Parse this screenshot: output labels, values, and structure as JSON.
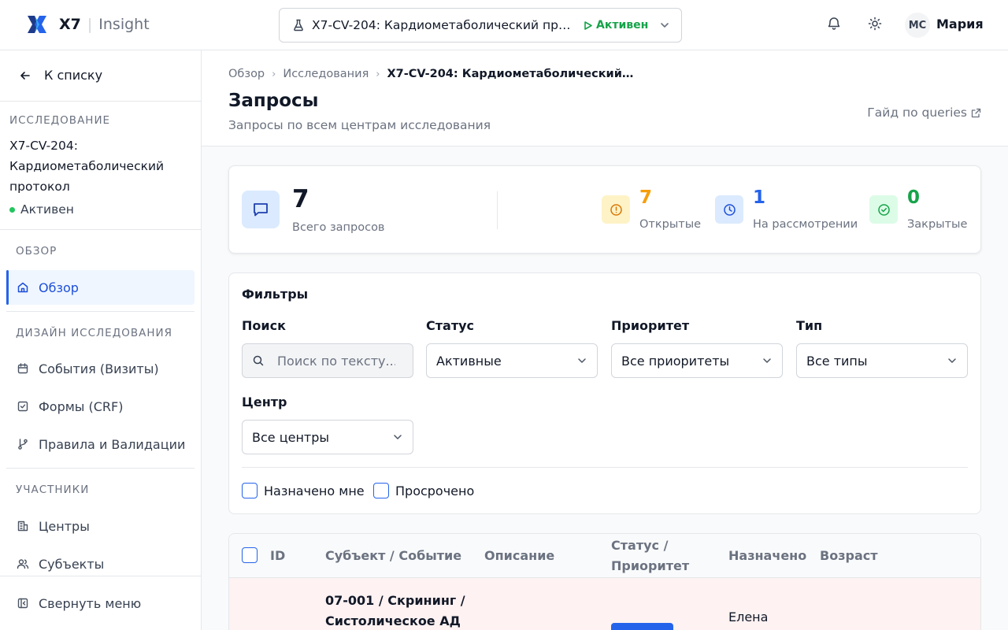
{
  "header": {
    "brand": "X7",
    "product": "Insight",
    "study": "X7-CV-204: Кардиометаболический протокол",
    "study_status": "Активен",
    "user_initials": "МС",
    "user_name": "Мария"
  },
  "sidebar": {
    "back_label": "К списку",
    "study_section": "ИССЛЕДОВАНИЕ",
    "study_name": "X7-CV-204: Кардиометаболический протокол",
    "study_status": "Активен",
    "sections": {
      "overview": "ОБЗОР",
      "design": "ДИЗАЙН ИССЛЕДОВАНИЯ",
      "participants": "УЧАСТНИКИ"
    },
    "items": {
      "overview": "Обзор",
      "events": "События (Визиты)",
      "forms": "Формы (CRF)",
      "rules": "Правила и Валидации",
      "sites": "Центры",
      "subjects": "Субъекты"
    },
    "collapse_label": "Свернуть меню"
  },
  "page": {
    "breadcrumbs": [
      "Обзор",
      "Исследования",
      "X7-CV-204: Кардиометаболический протокол"
    ],
    "title": "Запросы",
    "subtitle": "Запросы по всем центрам исследования",
    "guide_link": "Гайд по queries"
  },
  "stats": {
    "total_value": "7",
    "total_label": "Всего запросов",
    "open_value": "7",
    "open_label": "Открытые",
    "review_value": "1",
    "review_label": "На рассмотрении",
    "closed_value": "0",
    "closed_label": "Закрытые",
    "colors": {
      "open": "#f59e0b",
      "review": "#2563eb",
      "closed": "#16a34a"
    }
  },
  "filters": {
    "title": "Фильтры",
    "search_label": "Поиск",
    "search_placeholder": "Поиск по тексту...",
    "status_label": "Статус",
    "status_value": "Активные",
    "priority_label": "Приоритет",
    "priority_value": "Все приоритеты",
    "type_label": "Тип",
    "type_value": "Все типы",
    "site_label": "Центр",
    "site_value": "Все центры",
    "assigned_to_me": "Назначено мне",
    "overdue": "Просрочено"
  },
  "table": {
    "columns": {
      "id": "ID",
      "subject_event": "Субъект / Событие",
      "description": "Описание",
      "status_priority": "Статус / Приоритет",
      "assigned": "Назначено",
      "age": "Возраст"
    },
    "rows": [
      {
        "subject_event": "07-001 / Скрининг / Систолическое АД",
        "assigned": "Елена"
      }
    ]
  }
}
